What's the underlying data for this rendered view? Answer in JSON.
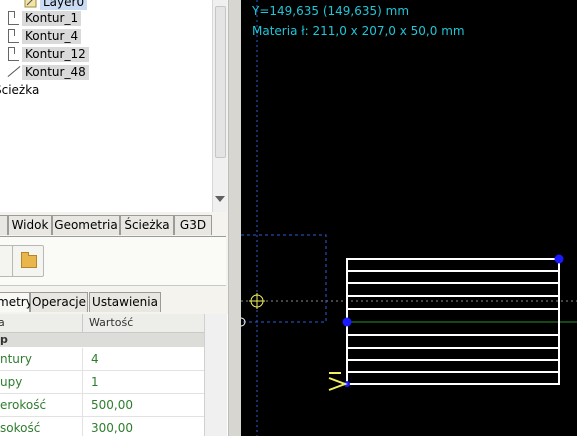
{
  "tree": {
    "items": [
      {
        "label": "Layer0",
        "icon": "layer-icon",
        "selected": true
      },
      {
        "label": "Kontur_1",
        "icon": "contour-icon"
      },
      {
        "label": "Kontur_4",
        "icon": "contour-icon"
      },
      {
        "label": "Kontur_12",
        "icon": "contour-icon"
      },
      {
        "label": "Kontur_48",
        "icon": "line-icon"
      }
    ],
    "path_label": "Ścieżka"
  },
  "tabs_top": [
    "Widok",
    "Geometria",
    "Ścieżka",
    "G3D"
  ],
  "toolbar": {
    "open_icon": "folder-icon"
  },
  "tabs_bottom": [
    "metry",
    "Operacje",
    "Ustawienia"
  ],
  "table": {
    "col_name": "a",
    "col_value": "Wartość",
    "group": "p",
    "rows": [
      {
        "key": "ntury",
        "value": "4"
      },
      {
        "key": "upy",
        "value": "1"
      },
      {
        "key": "erokość",
        "value": "500,00"
      },
      {
        "key": "sokość",
        "value": "300,00"
      }
    ]
  },
  "canvas": {
    "coord_y": "Y=149,635 (149,635) mm",
    "material": "Materia ł: 211,0 x 207,0 x 50,0 mm",
    "colors": {
      "background": "#000000",
      "text": "#1ec6d8",
      "handle": "#1a1aff",
      "dashed": "#2a5bd8",
      "crosshair": "#f0f060"
    }
  }
}
